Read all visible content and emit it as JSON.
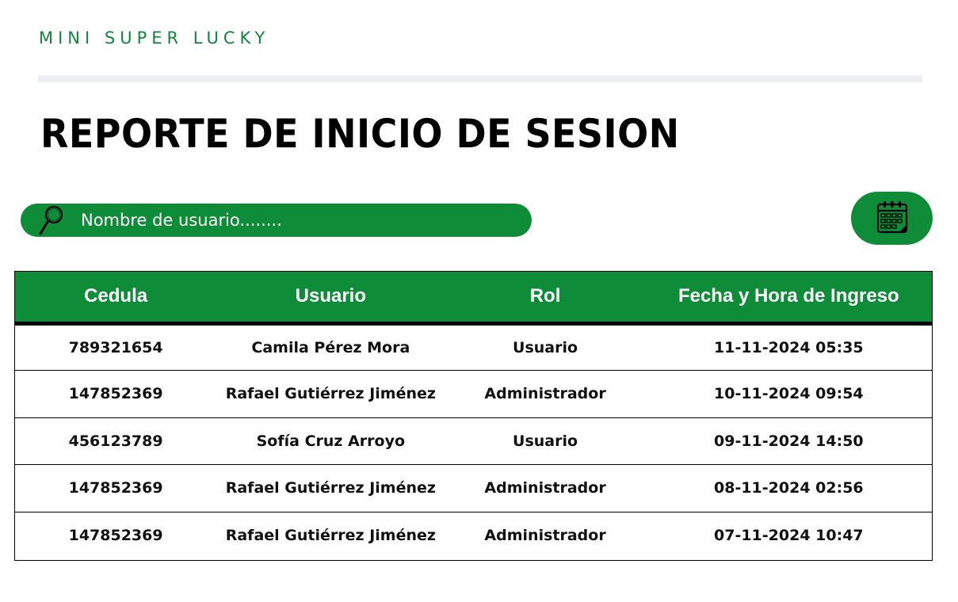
{
  "brand": {
    "name": "MINI SUPER LUCKY"
  },
  "page": {
    "title": "REPORTE DE INICIO DE SESION"
  },
  "search": {
    "placeholder": "Nombre de usuario........",
    "value": "",
    "icon": "magnifier-icon"
  },
  "calendar_button": {
    "icon": "calendar-icon"
  },
  "colors": {
    "accent": "#0f8c38",
    "brand_text": "#14863a",
    "divider": "#eceef1"
  },
  "table": {
    "headers": [
      "Cedula",
      "Usuario",
      "Rol",
      "Fecha y Hora de Ingreso"
    ],
    "rows": [
      [
        "789321654",
        "Camila Pérez Mora",
        "Usuario",
        "11-11-2024 05:35"
      ],
      [
        "147852369",
        "Rafael Gutiérrez Jiménez",
        "Administrador",
        "10-11-2024 09:54"
      ],
      [
        "456123789",
        "Sofía Cruz Arroyo",
        "Usuario",
        "09-11-2024 14:50"
      ],
      [
        "147852369",
        "Rafael Gutiérrez Jiménez",
        "Administrador",
        "08-11-2024 02:56"
      ],
      [
        "147852369",
        "Rafael Gutiérrez Jiménez",
        "Administrador",
        "07-11-2024 10:47"
      ]
    ]
  }
}
